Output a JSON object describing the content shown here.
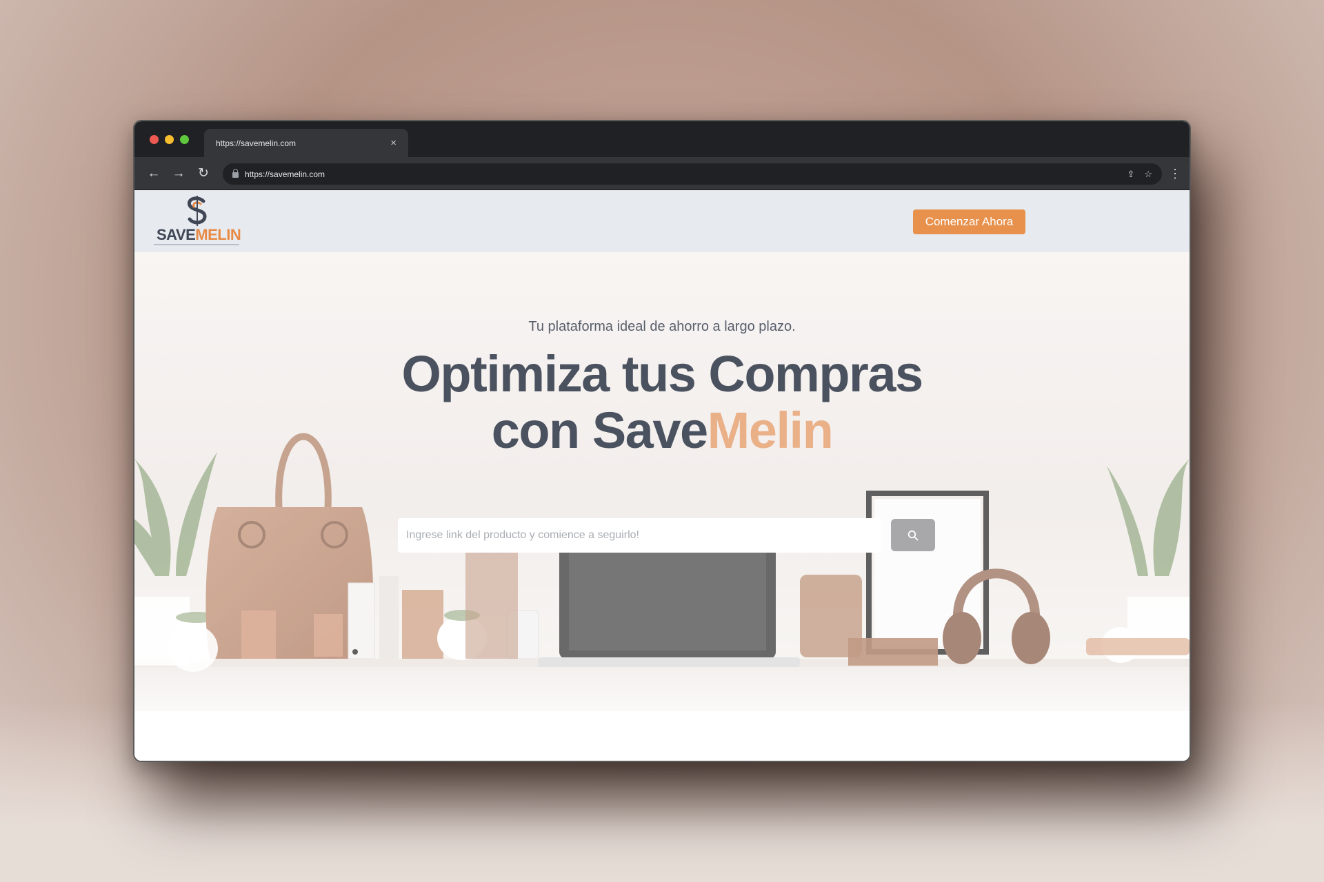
{
  "browser": {
    "tab_title": "https://savemelin.com",
    "tab_close": "×",
    "url": "https://savemelin.com",
    "back_icon": "←",
    "forward_icon": "→",
    "reload_icon": "↻",
    "share_icon": "⇪",
    "bookmark_icon": "☆",
    "menu_icon": "⋮"
  },
  "header": {
    "logo_word_a": "SAVE",
    "logo_word_b": "MELIN",
    "cta_label": "Comenzar Ahora"
  },
  "hero": {
    "subtitle": "Tu plataforma ideal de ahorro a largo plazo.",
    "title_highlight": "Optimiza",
    "title_rest_line1": " tus Compras",
    "title_line2_a": "con Save",
    "title_line2_accent": "Melin",
    "search_placeholder": "Ingrese link del producto y comience a seguirlo!"
  },
  "colors": {
    "accent": "#e8914c",
    "heading": "#4b525f",
    "header_bg": "#e7eaef",
    "chrome_dark": "#202124"
  },
  "icons": [
    "search-icon",
    "lock-icon",
    "share-icon",
    "star-icon",
    "close-icon",
    "kebab-menu-icon"
  ]
}
